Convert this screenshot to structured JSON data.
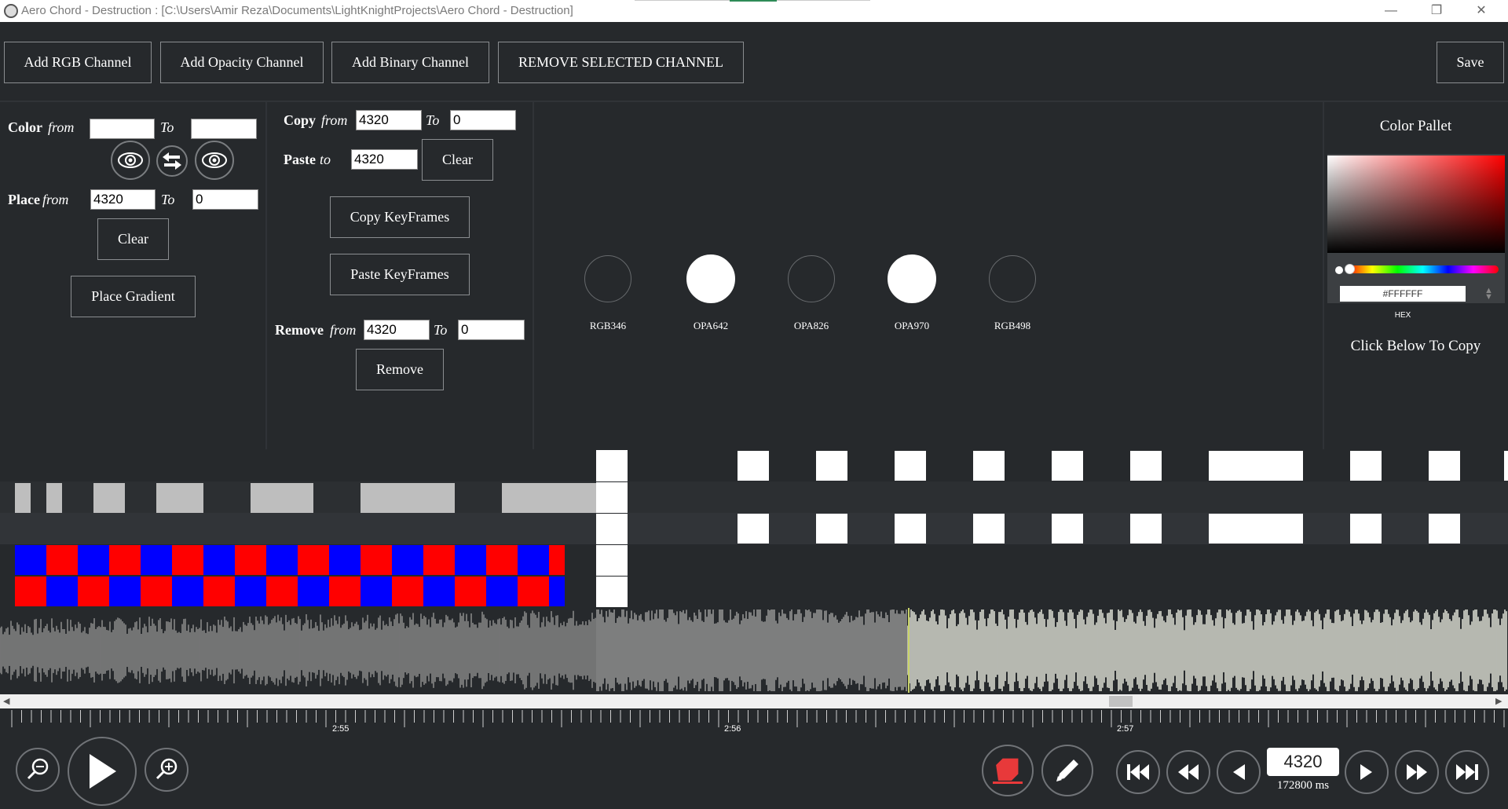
{
  "window": {
    "title": "Aero Chord - Destruction : [C:\\Users\\Amir Reza\\Documents\\LightKnightProjects\\Aero Chord - Destruction]",
    "minimize": "—",
    "maximize": "❐",
    "close": "✕"
  },
  "toolbar": {
    "add_rgb": "Add RGB Channel",
    "add_opacity": "Add Opacity Channel",
    "add_binary": "Add Binary Channel",
    "remove_selected": "REMOVE SELECTED CHANNEL",
    "save": "Save"
  },
  "color_panel": {
    "color_label": "Color",
    "from_label": "from",
    "to_label": "To",
    "color_from": "",
    "color_to": "",
    "place_label": "Place",
    "place_from": "4320",
    "place_to": "0",
    "clear": "Clear",
    "place_gradient": "Place Gradient"
  },
  "copy_panel": {
    "copy_label": "Copy",
    "from_label": "from",
    "to_label": "To",
    "copy_from": "4320",
    "copy_to": "0",
    "paste_label": "Paste",
    "paste_to_label": "to",
    "paste_to": "4320",
    "clear": "Clear",
    "copy_keyframes": "Copy KeyFrames",
    "paste_keyframes": "Paste KeyFrames",
    "remove_label": "Remove",
    "remove_from": "4320",
    "remove_to": "0",
    "remove": "Remove"
  },
  "channels": [
    {
      "name": "RGB346",
      "filled": false
    },
    {
      "name": "OPA642",
      "filled": true
    },
    {
      "name": "OPA826",
      "filled": false
    },
    {
      "name": "OPA970",
      "filled": true
    },
    {
      "name": "RGB498",
      "filled": false
    }
  ],
  "color_pallet": {
    "title": "Color Pallet",
    "hex_value": "#FFFFFF",
    "hex_label": "HEX",
    "copy_hint": "Click Below To Copy"
  },
  "timeline": {
    "ticks": [
      "2:55",
      "2:56",
      "2:57"
    ]
  },
  "transport": {
    "frame": "4320",
    "ms": "172800 ms"
  },
  "colors": {
    "background": "#26292c",
    "track_alt": "#313438",
    "gray_block": "#bebebe",
    "red": "#ff0000",
    "blue": "#0000ff",
    "eraser": "#e8393a"
  }
}
